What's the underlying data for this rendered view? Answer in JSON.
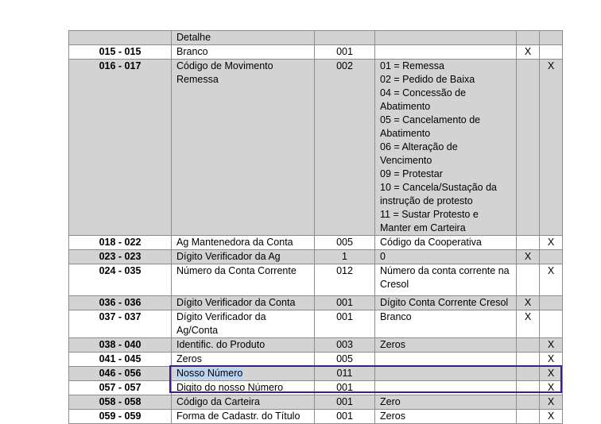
{
  "table": {
    "rows": [
      {
        "pos": "",
        "name": "Detalhe",
        "size": "",
        "fill": "",
        "x1": "",
        "x2": "",
        "gray": true
      },
      {
        "pos": "015 - 015",
        "name": "Branco",
        "size": "001",
        "fill": "",
        "x1": "X",
        "x2": "",
        "gray": false
      },
      {
        "pos": "016 - 017",
        "name": "Código de Movimento Remessa",
        "size": "002",
        "fill": "01 = Remessa\n02 = Pedido de Baixa\n04 = Concessão de Abatimento\n05 = Cancelamento de Abatimento\n06 = Alteração de Vencimento\n09 = Protestar\n10 = Cancela/Sustação da instrução de protesto\n11 = Sustar Protesto e Manter em Carteira",
        "x1": "",
        "x2": "X",
        "gray": true
      },
      {
        "pos": "018 - 022",
        "name": "Ag Mantenedora da Conta",
        "size": "005",
        "fill": "Código da Cooperativa",
        "x1": "",
        "x2": "X",
        "gray": false
      },
      {
        "pos": "023 - 023",
        "name": "Dígito Verificador da Ag",
        "size": "1",
        "fill": "0",
        "x1": "X",
        "x2": "",
        "gray": true
      },
      {
        "pos": "024 - 035",
        "name": "Número da Conta Corrente",
        "size": "012",
        "fill": "Número da conta corrente na Cresol",
        "x1": "",
        "x2": "X",
        "gray": false,
        "tall": true
      },
      {
        "pos": "036 - 036",
        "name": "Dígito Verificador da Conta",
        "size": "001",
        "fill": "Dígito Conta Corrente Cresol",
        "x1": "X",
        "x2": "",
        "gray": true
      },
      {
        "pos": "037 - 037",
        "name": "Dígito Verificador da Ag/Conta",
        "size": "001",
        "fill": "Branco",
        "x1": "X",
        "x2": "",
        "gray": false
      },
      {
        "pos": "038 - 040",
        "name": "Identific. do Produto",
        "size": "003",
        "fill": "Zeros",
        "x1": "",
        "x2": "X",
        "gray": true
      },
      {
        "pos": "041 - 045",
        "name": "Zeros",
        "size": "005",
        "fill": "",
        "x1": "",
        "x2": "X",
        "gray": false
      },
      {
        "pos": "046 - 056",
        "name": "Nosso Número",
        "size": "011",
        "fill": "",
        "x1": "",
        "x2": "X",
        "gray": true,
        "hl": true
      },
      {
        "pos": "057 - 057",
        "name": "Digito do nosso Número",
        "size": "001",
        "fill": "",
        "x1": "",
        "x2": "X",
        "gray": false
      },
      {
        "pos": "058 - 058",
        "name": "Código da Carteira",
        "size": "001",
        "fill": "Zero",
        "x1": "",
        "x2": "X",
        "gray": true
      },
      {
        "pos": "059 - 059",
        "name": "Forma de Cadastr. do Título",
        "size": "001",
        "fill": "Zeros",
        "x1": "",
        "x2": "X",
        "gray": false
      }
    ]
  }
}
